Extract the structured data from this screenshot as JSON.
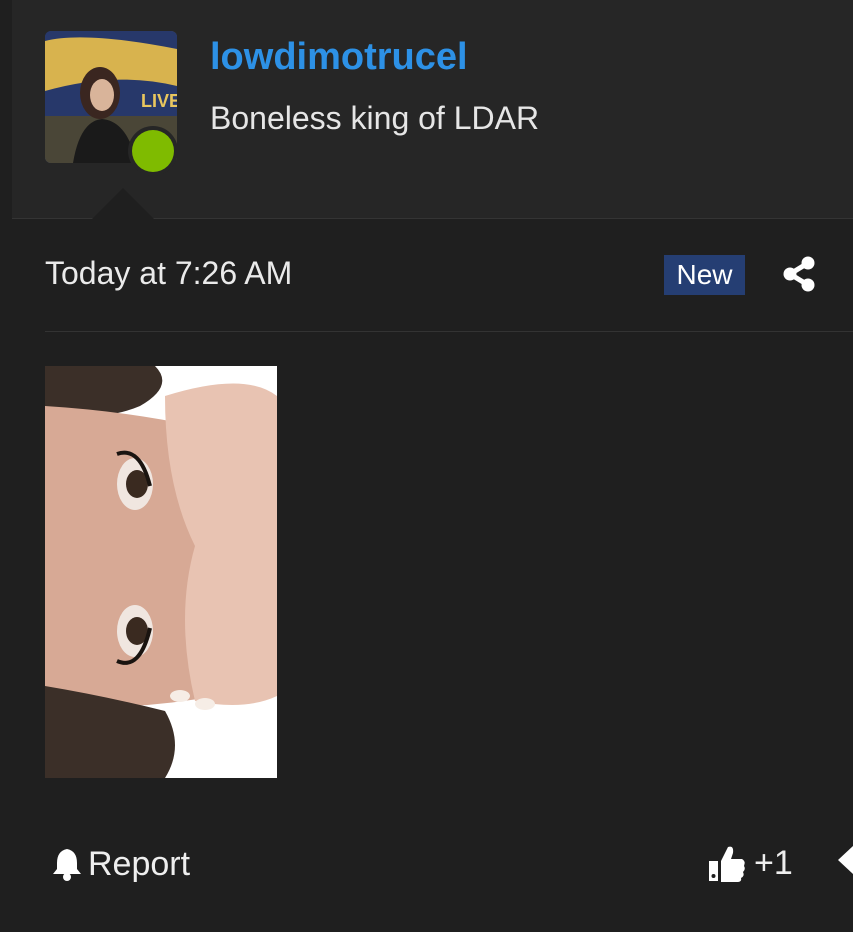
{
  "user": {
    "name": "lowdimotrucel",
    "title": "Boneless king of LDAR",
    "avatar_caption": "LIVE!",
    "status": "online",
    "name_color": "#2d91e6",
    "online_color": "#7fbb00"
  },
  "post": {
    "timestamp": "Today at 7:26 AM",
    "badge": "New",
    "badge_color": "#253e73",
    "share_icon": "share-icon",
    "attachment_icon": "image-attachment"
  },
  "actions": {
    "report_label": "Report",
    "report_icon": "bell-icon",
    "like_label": "+1",
    "like_icon": "thumbs-up-icon",
    "next_icon": "caret-left-icon"
  }
}
